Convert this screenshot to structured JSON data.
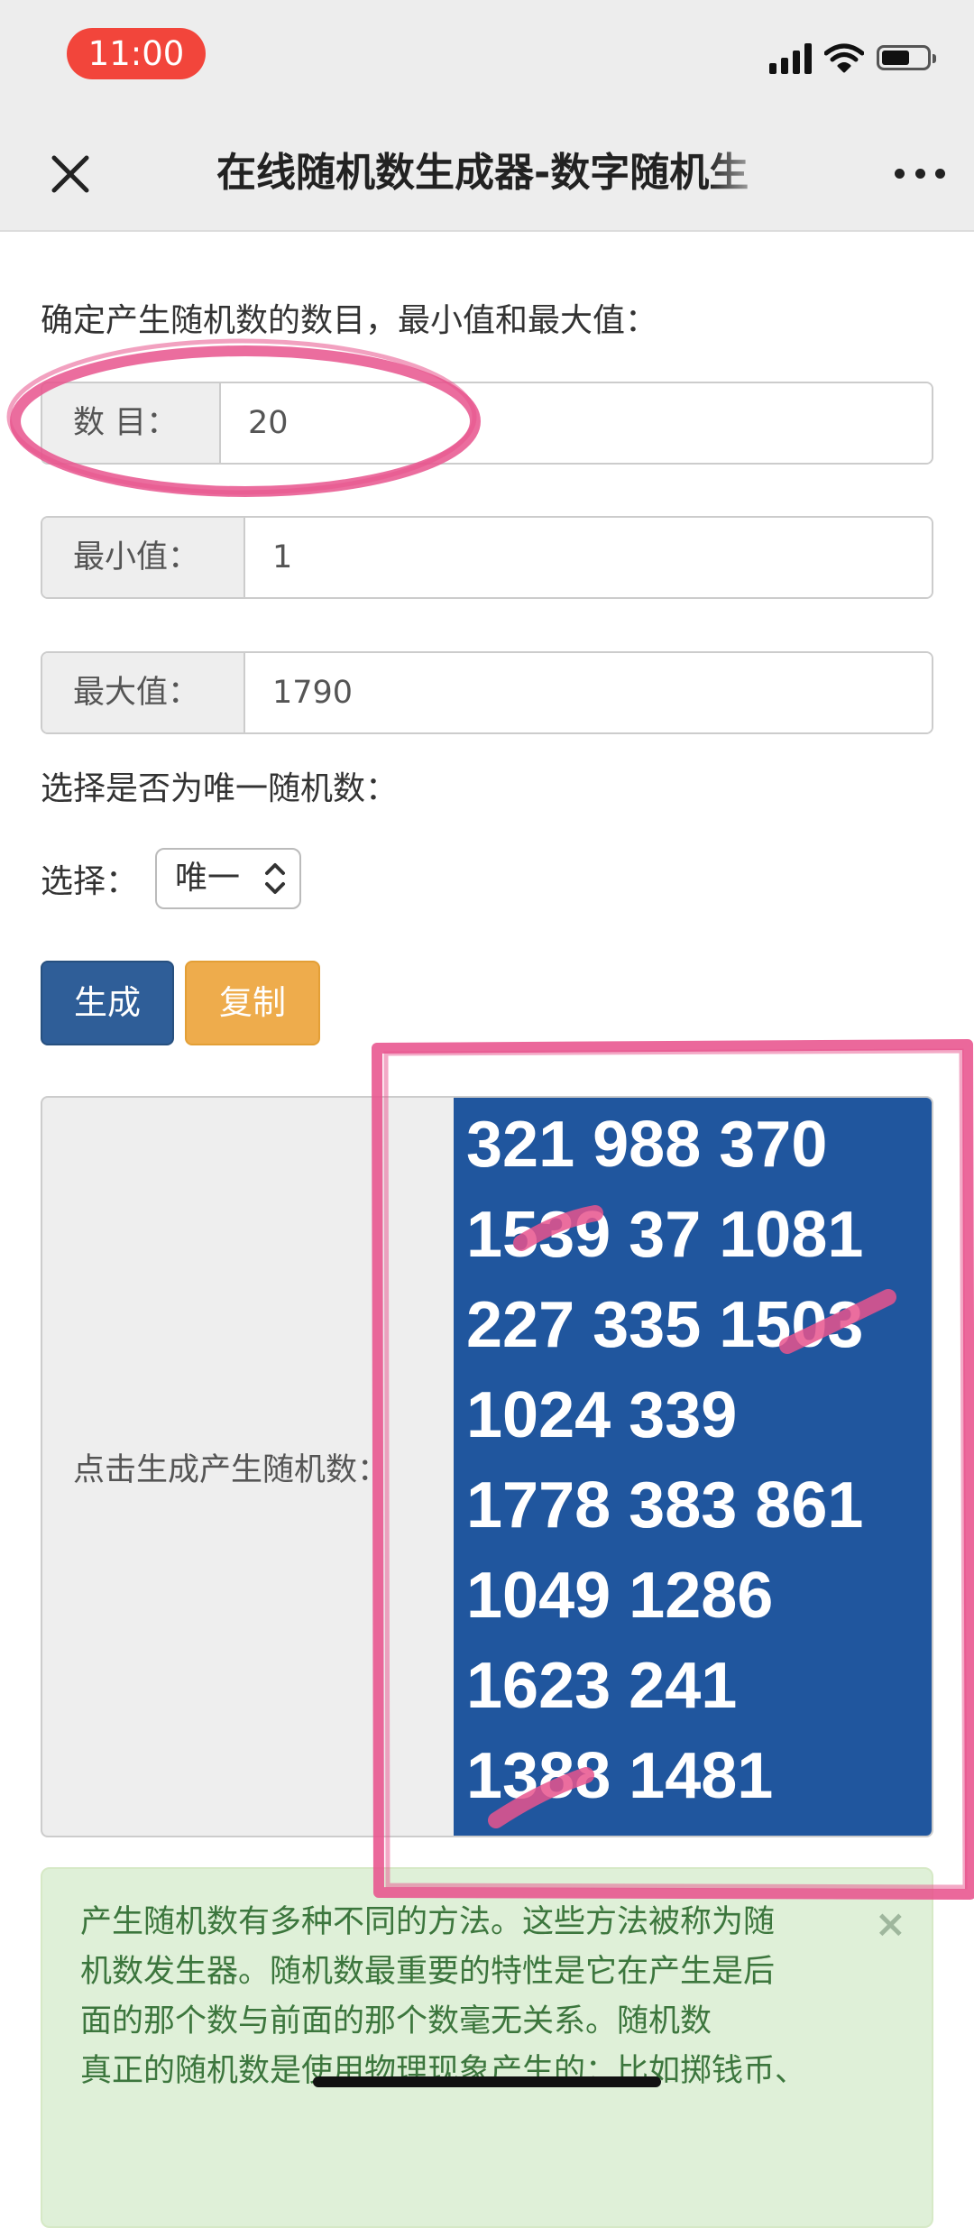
{
  "status_bar": {
    "time": "11:00",
    "icons": [
      "signal-icon",
      "wifi-icon",
      "battery-icon"
    ]
  },
  "nav": {
    "title": "在线随机数生成器-数字随机生",
    "close_icon": "close-icon",
    "more_icon": "more-icon"
  },
  "form": {
    "intro": "确定产生随机数的数目，最小值和最大值：",
    "count": {
      "label": "数 目：",
      "value": "20"
    },
    "min": {
      "label": "最小值：",
      "value": "1"
    },
    "max": {
      "label": "最大值：",
      "value": "1790"
    },
    "unique_prompt": "选择是否为唯一随机数：",
    "select_label": "选择：",
    "select_value": "唯一"
  },
  "buttons": {
    "generate": "生成",
    "copy": "复制"
  },
  "result": {
    "label": "点击生成产生随机数：",
    "lines": [
      "321 988 370",
      "1539 37 1081",
      "227 335 1503",
      "1024 339",
      "1778 383 861",
      "1049 1286",
      "1623 241",
      "1388 1481"
    ]
  },
  "alert": {
    "lines": [
      "产生随机数有多种不同的方法。这些方法被称为随",
      "机数发生器。随机数最重要的特性是它在产生是后",
      "面的那个数与前面的那个数毫无关系。随机数",
      "真正的随机数是使用物理现象产生的：比如掷钱币、"
    ],
    "close": "×"
  },
  "colors": {
    "annotation_pink": "#e8538d",
    "result_blue": "#20569e",
    "generate_blue": "#2f5e98",
    "copy_orange": "#eeac4c",
    "alert_green_bg": "#dff0d8"
  }
}
